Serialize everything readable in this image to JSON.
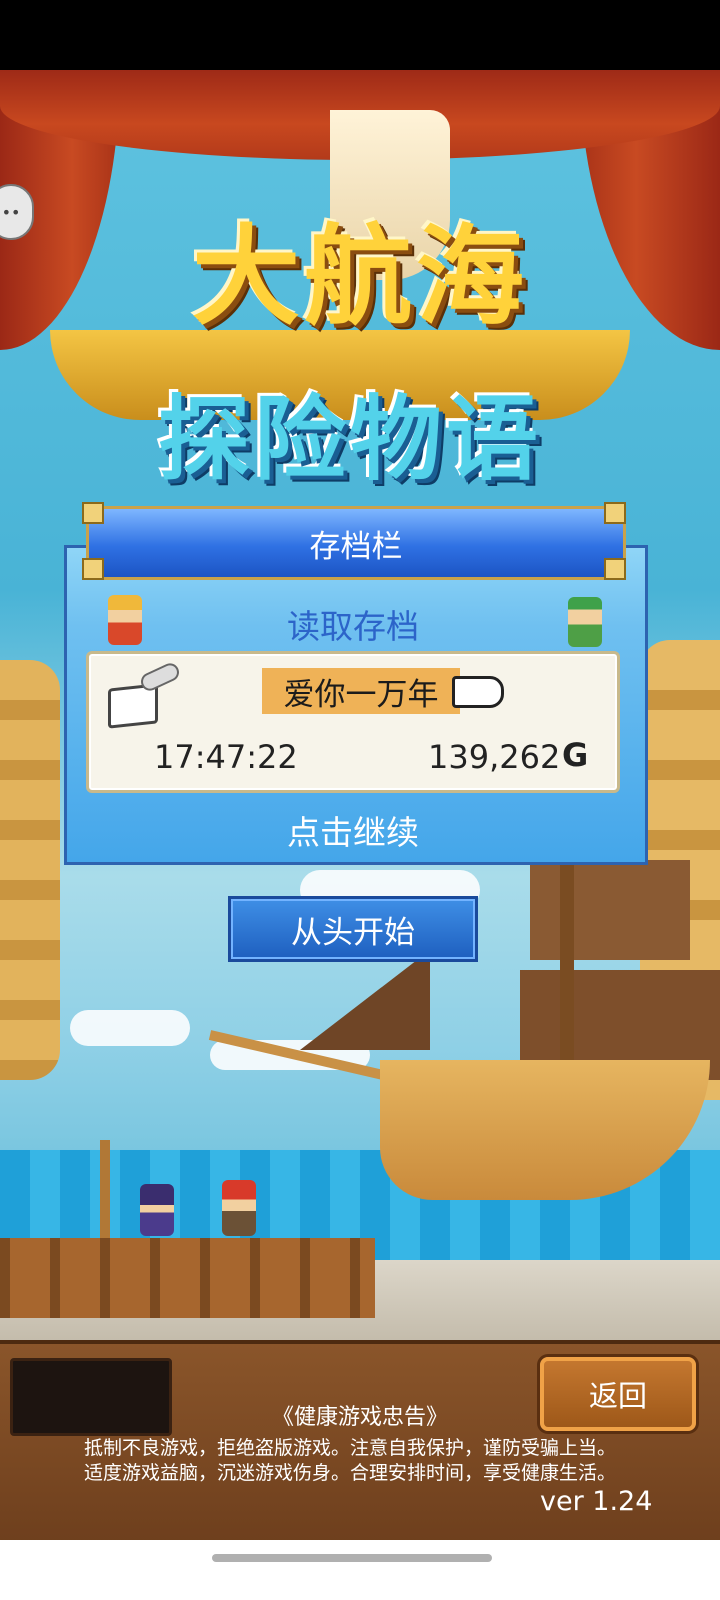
{
  "game": {
    "logo_line1": "大航海",
    "logo_line2": "探险物语"
  },
  "save_panel": {
    "header": "存档栏",
    "load_title": "读取存档",
    "save_slot": {
      "name": "爱你一万年",
      "time": "17:47:22",
      "gold": "139,262",
      "gold_unit": "G"
    },
    "continue_label": "点击继续"
  },
  "new_game_label": "从头开始",
  "footer": {
    "back_label": "返回",
    "advisory_title": "《健康游戏忠告》",
    "advisory_lines": [
      "抵制不良游戏，拒绝盗版游戏。注意自我保护，谨防受骗上当。",
      "适度游戏益脑，沉迷游戏伤身。合理安排时间，享受健康生活。"
    ],
    "version": "ver 1.24"
  },
  "icons": {
    "book": "open-book-icon",
    "quill": "quill-icon",
    "pointer": "pointing-hand-icon",
    "side": "side-menu-face-icon"
  },
  "colors": {
    "panel_blue": "#44a6ea",
    "header_blue": "#2f71e3",
    "name_highlight": "#efb257",
    "button_blue": "#1e5fbf",
    "footer_brown": "#7a4721",
    "back_button": "#b0661f"
  }
}
